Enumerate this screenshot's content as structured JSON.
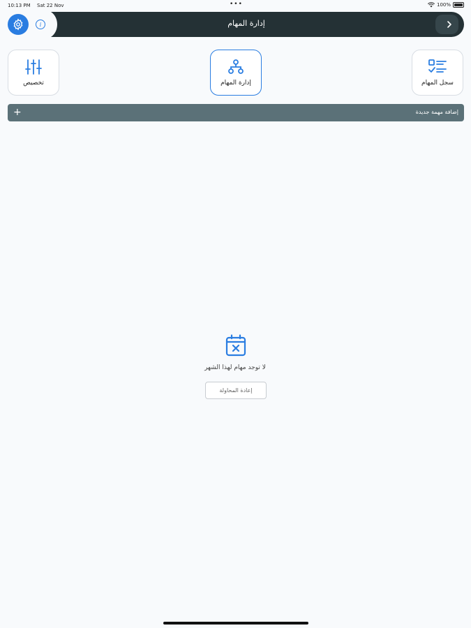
{
  "status_bar": {
    "time": "10:13 PM",
    "date": "Sat 22 Nov",
    "dots": "•••",
    "battery": "100%"
  },
  "header": {
    "title": "إدارة المهام",
    "settings_icon": "gear-icon",
    "info_icon": "info-icon",
    "back_icon": "chevron-right-icon",
    "info_glyph": "i"
  },
  "tiles": [
    {
      "label": "تخصيص",
      "icon": "sliders-icon"
    },
    {
      "label": "إدارة المهام",
      "icon": "hierarchy-icon",
      "active": true
    },
    {
      "label": "سجل المهام",
      "icon": "checklist-icon"
    }
  ],
  "add_task": {
    "label": "إضافة مهمة جديدة",
    "plus": "+"
  },
  "empty_state": {
    "icon": "calendar-x-icon",
    "message": "لا توجد مهام لهذا الشهر",
    "retry_label": "إعادة المحاولة"
  },
  "colors": {
    "accent": "#2a7de1",
    "header_bg": "#243135",
    "add_bar_bg": "#5b7178",
    "page_bg": "#f8fafc"
  }
}
